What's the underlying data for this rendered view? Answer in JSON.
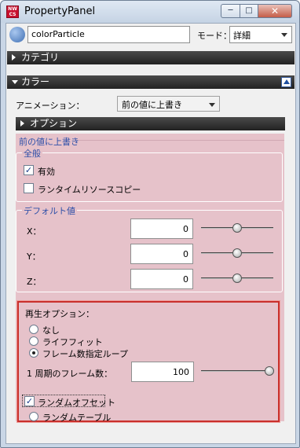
{
  "window": {
    "app_icon_text": "NW CS",
    "title": "PropertyPanel",
    "minimize_symbol": "─",
    "maximize_symbol": "□",
    "close_symbol": "✕"
  },
  "toolbar": {
    "object_name": "colorParticle",
    "mode_label": "モード：",
    "mode_value": "詳細"
  },
  "sections": {
    "category": "カテゴリ",
    "color": "カラー",
    "options": "オプション"
  },
  "animation": {
    "label": "アニメーション：",
    "value": "前の値に上書き"
  },
  "override": {
    "title": "前の値に上書き",
    "general": {
      "label": "全般",
      "enabled_label": "有効",
      "enabled_checked": true,
      "runtime_copy_label": "ランタイムリソースコピー",
      "runtime_copy_checked": false
    },
    "defaults": {
      "label": "デフォルト値",
      "fields": [
        {
          "label": "X：",
          "value": "0",
          "slider": 0.5
        },
        {
          "label": "Y：",
          "value": "0",
          "slider": 0.5
        },
        {
          "label": "Z：",
          "value": "0",
          "slider": 0.5
        }
      ]
    }
  },
  "playback": {
    "label": "再生オプション：",
    "options": [
      "なし",
      "ライフフィット",
      "フレーム数指定ループ"
    ],
    "selected_index": 2,
    "frames_label": "1 周期のフレーム数：",
    "frames_value": "100",
    "frames_slider": 1.0,
    "random_offset_label": "ランダムオフセット",
    "random_offset_checked": true,
    "random_table_label": "ランダムテーブル"
  }
}
